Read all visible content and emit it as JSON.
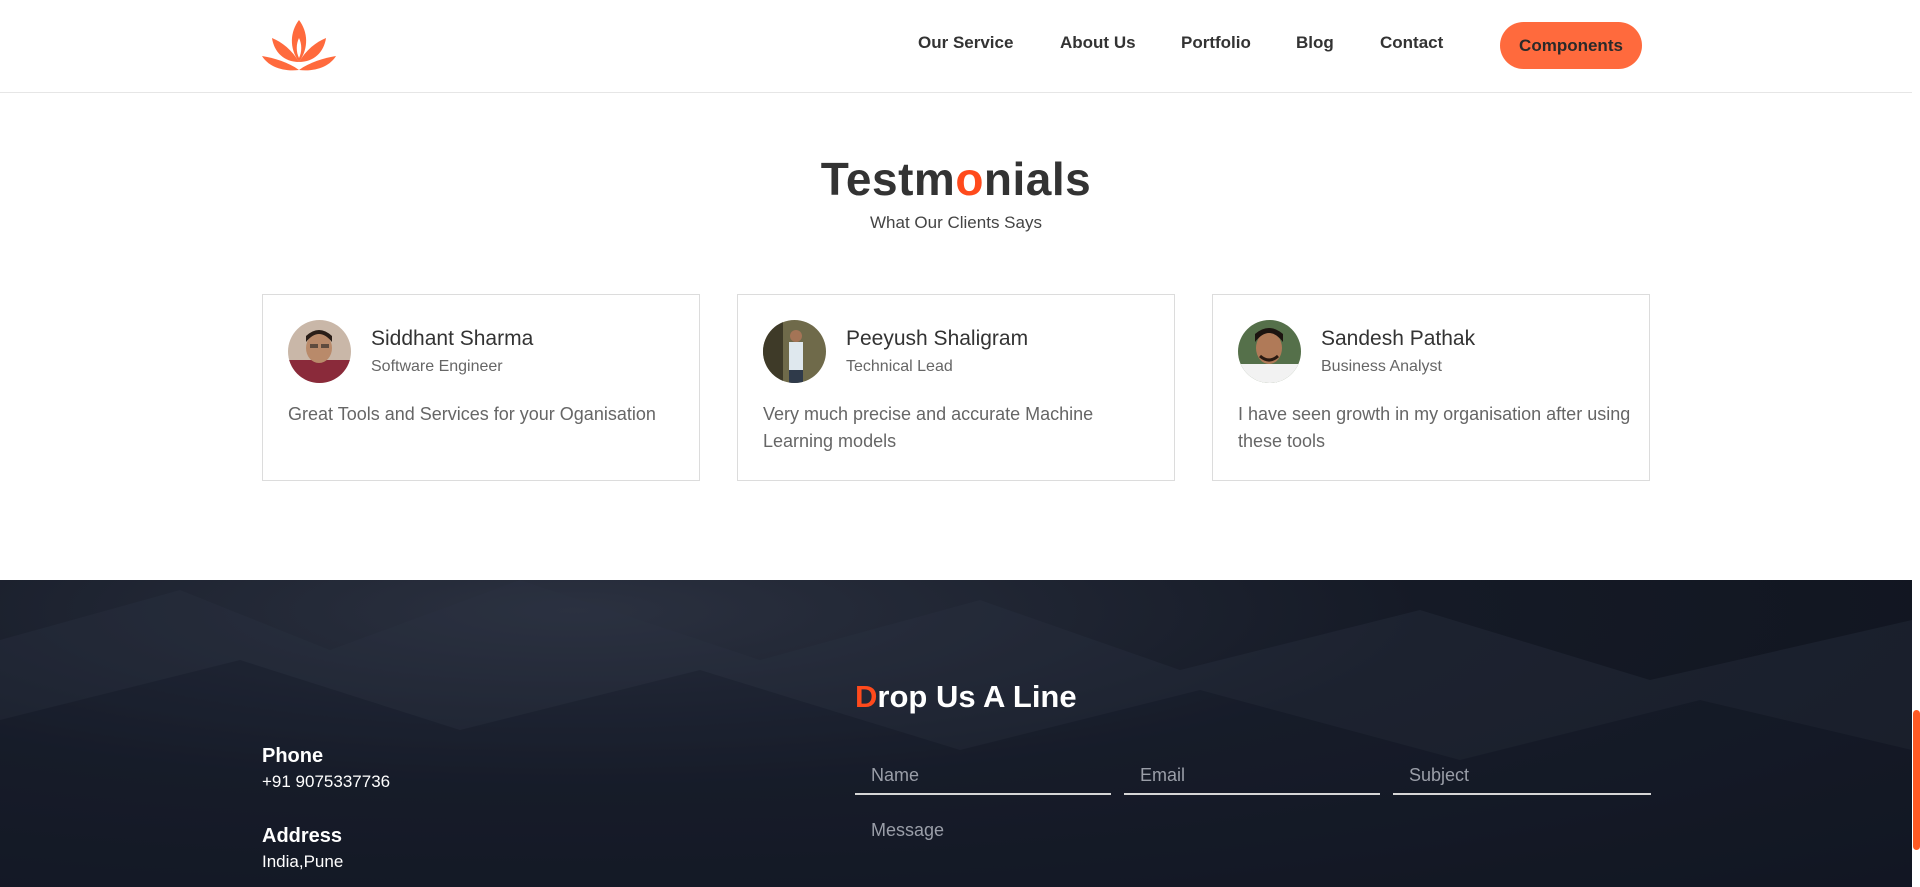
{
  "header": {
    "nav": [
      {
        "label": "Our Service"
      },
      {
        "label": "About Us"
      },
      {
        "label": "Portfolio"
      },
      {
        "label": "Blog"
      },
      {
        "label": "Contact"
      }
    ],
    "cta_label": "Components",
    "accent": "#ff6a3d"
  },
  "testimonials": {
    "title_before": "Testm",
    "title_highlight": "o",
    "title_after": "nials",
    "subtitle": "What Our Clients Says",
    "items": [
      {
        "name": "Siddhant Sharma",
        "role": "Software Engineer",
        "text": "Great Tools and Services for your Oganisation"
      },
      {
        "name": "Peeyush Shaligram",
        "role": "Technical Lead",
        "text": "Very much precise and accurate Machine Learning models"
      },
      {
        "name": "Sandesh Pathak",
        "role": "Business Analyst",
        "text": "I have seen growth in my organisation after using these tools"
      }
    ]
  },
  "footer": {
    "form_title_highlight": "D",
    "form_title_rest": "rop Us A Line",
    "phone_label": "Phone",
    "phone_value": "+91 9075337736",
    "address_label": "Address",
    "address_value": "India,Pune",
    "placeholders": {
      "name": "Name",
      "email": "Email",
      "subject": "Subject",
      "message": "Message"
    }
  },
  "colors": {
    "highlight": "#ff4a1c",
    "footer_bg": "#151a26"
  }
}
